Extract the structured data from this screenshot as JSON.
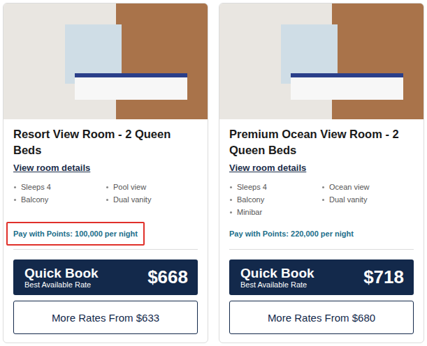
{
  "rooms": [
    {
      "title": "Resort View Room - 2 Queen Beds",
      "details_link": "View room details",
      "features": [
        "Sleeps 4",
        "Pool view",
        "Balcony",
        "Dual vanity"
      ],
      "points": "Pay with Points: 100,000 per night",
      "highlighted": true,
      "quick_book": {
        "label": "Quick Book",
        "sublabel": "Best Available Rate",
        "price": "$668"
      },
      "more_rates": "More Rates From $633"
    },
    {
      "title": "Premium Ocean View Room - 2 Queen Beds",
      "details_link": "View room details",
      "features": [
        "Sleeps 4",
        "Ocean view",
        "Balcony",
        "Dual vanity",
        "Minibar"
      ],
      "points": "Pay with Points: 220,000 per night",
      "highlighted": false,
      "quick_book": {
        "label": "Quick Book",
        "sublabel": "Best Available Rate",
        "price": "$718"
      },
      "more_rates": "More Rates From $680"
    }
  ]
}
